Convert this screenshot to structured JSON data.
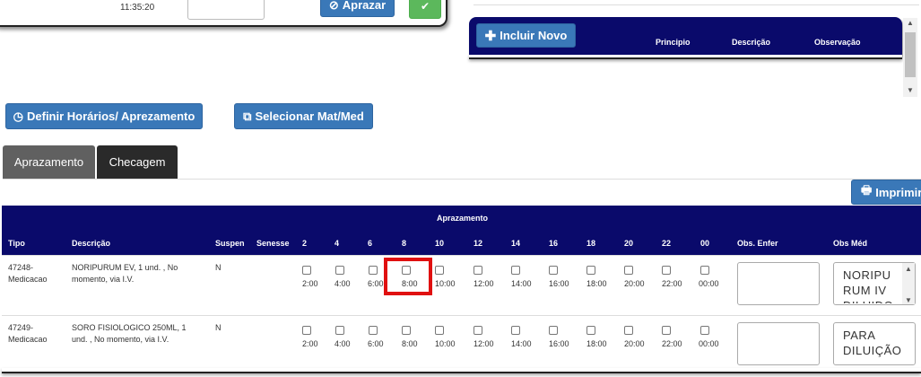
{
  "top_left": {
    "time": "11:35:20",
    "aprazar_label": "Aprazar"
  },
  "top_right": {
    "include_label": "Incluir Novo",
    "headers": [
      "Principio",
      "Descrição",
      "Observação"
    ]
  },
  "actions": {
    "define_label": "Definir Horários/ Aprezamento",
    "select_label": "Selecionar Mat/Med",
    "print_label": "Imprimir"
  },
  "tabs": [
    {
      "label": "Aprazamento",
      "active": true
    },
    {
      "label": "Checagem",
      "active": false
    }
  ],
  "table": {
    "group_title": "Aprazamento",
    "columns": [
      "Tipo",
      "Descrição",
      "Suspen",
      "Senesse",
      "2",
      "4",
      "6",
      "8",
      "10",
      "12",
      "14",
      "16",
      "18",
      "20",
      "22",
      "00",
      "Obs. Enfer",
      "Obs Méd"
    ],
    "times": [
      "2:00",
      "4:00",
      "6:00",
      "8:00",
      "10:00",
      "12:00",
      "14:00",
      "16:00",
      "18:00",
      "20:00",
      "22:00",
      "00:00"
    ],
    "rows": [
      {
        "tipo": [
          "47248-",
          "Medicacao"
        ],
        "descricao": [
          "NORIPURUM EV, 1 und. , No",
          "momento, via I.V."
        ],
        "suspen": "N",
        "obs_med": [
          "NORIPU",
          "RUM IV",
          "DILUIDO"
        ]
      },
      {
        "tipo": [
          "47249-",
          "Medicacao"
        ],
        "descricao": [
          "SORO FISIOLOGICO 250ML, 1",
          "und. , No momento, via I.V."
        ],
        "suspen": "N",
        "obs_med": [
          "PARA",
          "DILUIÇÃO"
        ]
      }
    ]
  },
  "colors": {
    "navy": "#0a0a6b",
    "button_blue": "#3a78b8",
    "green": "#5cb85c",
    "highlight": "#e01010"
  }
}
